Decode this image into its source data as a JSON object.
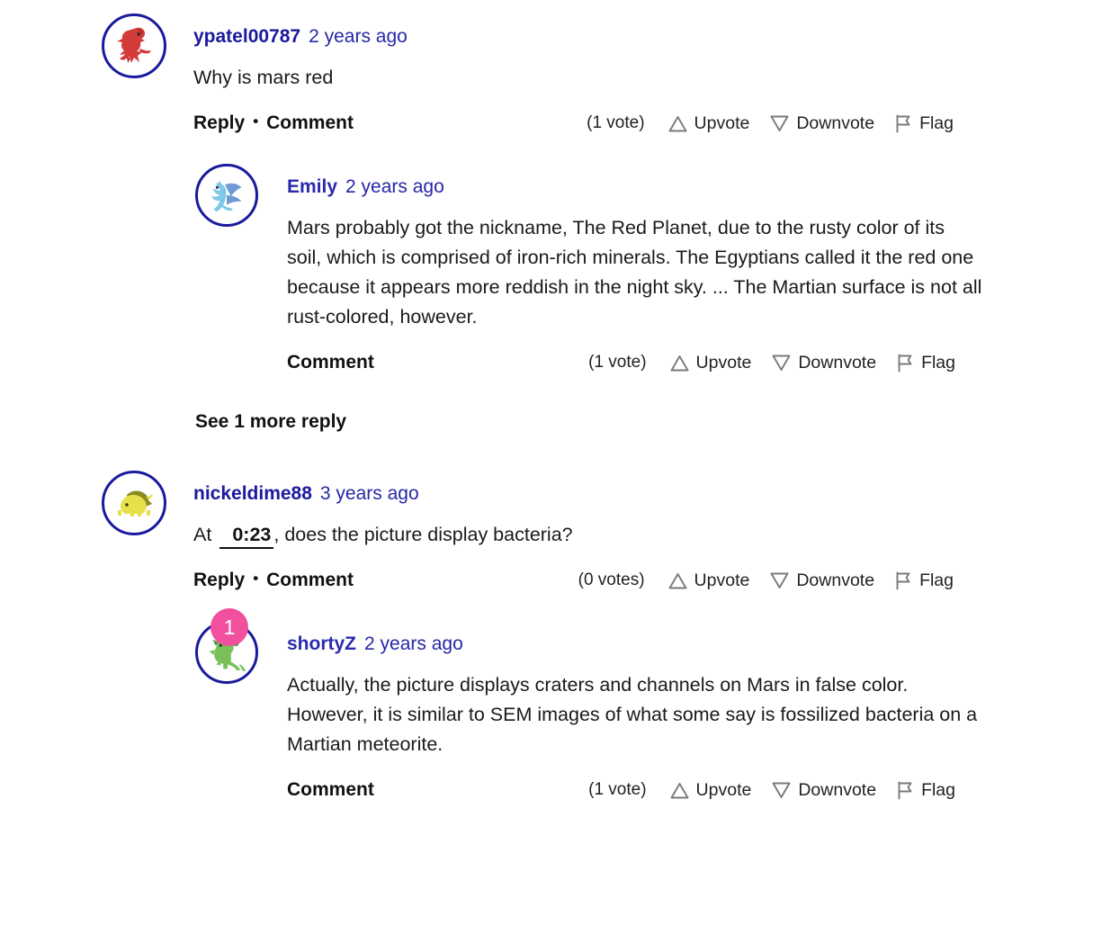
{
  "theme": {
    "link_blue": "#1a1a9e",
    "text_dark": "#1a1a1a",
    "icon_gray": "#7a7a7a",
    "badge_pink": "#f0509e",
    "avatar_ring": "#1a1a9e",
    "background": "#ffffff"
  },
  "labels": {
    "reply": "Reply",
    "comment": "Comment",
    "separator": "•",
    "upvote": "Upvote",
    "downvote": "Downvote",
    "flag": "Flag"
  },
  "see_more_replies": "See 1 more reply",
  "annotation": {
    "marker_1": "1"
  },
  "comments": [
    {
      "id": "c1",
      "level": 0,
      "username": "ypatel00787",
      "timestamp": "2 years ago",
      "text": "Why is mars red",
      "avatar": "red-dragon-avatar",
      "actions": {
        "show_reply": true,
        "reply": "Reply",
        "comment": "Comment",
        "votes": "(1 vote)",
        "upvote": "Upvote",
        "downvote": "Downvote",
        "flag": "Flag"
      }
    },
    {
      "id": "c2",
      "level": 1,
      "username": "Emily",
      "timestamp": "2 years ago",
      "text": "Mars probably got the nickname, The Red Planet, due to the rusty color of its soil, which is comprised of iron-rich minerals. The Egyptians called it the red one because it appears more reddish in the night sky. ... The Martian surface is not all rust-colored, however.",
      "avatar": "blue-winged-creature-avatar",
      "actions": {
        "show_reply": false,
        "comment": "Comment",
        "votes": "(1 vote)",
        "upvote": "Upvote",
        "downvote": "Downvote",
        "flag": "Flag"
      }
    },
    {
      "id": "c3",
      "level": 0,
      "username": "nickeldime88",
      "timestamp": "3 years ago",
      "text_before": "At",
      "timestamp_link": "0:23",
      "text_after": ", does the picture display bacteria?",
      "avatar": "yellow-creature-avatar",
      "actions": {
        "show_reply": true,
        "reply": "Reply",
        "comment": "Comment",
        "votes": "(0 votes)",
        "upvote": "Upvote",
        "downvote": "Downvote",
        "flag": "Flag"
      }
    },
    {
      "id": "c4",
      "level": 1,
      "username": "shortyZ",
      "timestamp": "2 years ago",
      "text": "Actually, the picture displays craters and channels on Mars in false color. However, it is similar to SEM images of what some say is fossilized bacteria on a Martian meteorite.",
      "avatar": "green-lizard-avatar",
      "actions": {
        "show_reply": false,
        "comment": "Comment",
        "votes": "(1 vote)",
        "upvote": "Upvote",
        "downvote": "Downvote",
        "flag": "Flag"
      }
    }
  ]
}
